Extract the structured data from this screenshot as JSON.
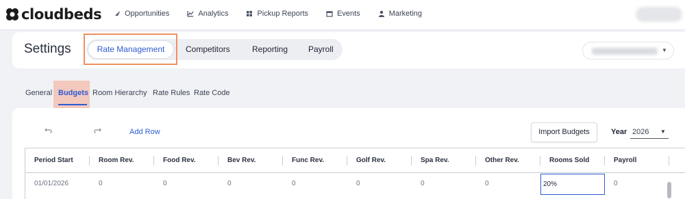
{
  "brand": {
    "name": "cloudbeds"
  },
  "nav": [
    {
      "label": "Opportunities",
      "icon": "rocket-icon"
    },
    {
      "label": "Analytics",
      "icon": "chart-icon"
    },
    {
      "label": "Pickup Reports",
      "icon": "grid-icon"
    },
    {
      "label": "Events",
      "icon": "calendar-icon"
    },
    {
      "label": "Marketing",
      "icon": "person-icon"
    }
  ],
  "settings": {
    "title": "Settings",
    "tabs": [
      "Rate Management",
      "Competitors",
      "Reporting",
      "Payroll"
    ],
    "active_tab": "Rate Management"
  },
  "subtabs": [
    "General",
    "Budgets",
    "Room Hierarchy",
    "Rate Rules",
    "Rate Code"
  ],
  "active_subtab": "Budgets",
  "toolbar": {
    "add_row_label": "Add Row",
    "import_label": "Import Budgets",
    "year_label": "Year",
    "year_value": "2026"
  },
  "table": {
    "columns": [
      "Period Start",
      "Room Rev.",
      "Food Rev.",
      "Bev Rev.",
      "Func Rev.",
      "Golf Rev.",
      "Spa Rev.",
      "Other Rev.",
      "Rooms Sold",
      "Payroll"
    ],
    "rows": [
      [
        "01/01/2026",
        "0",
        "0",
        "0",
        "0",
        "0",
        "0",
        "0",
        "20%",
        "0"
      ]
    ]
  },
  "colors": {
    "accent": "#2d5bd3",
    "highlight": "#f08f5e",
    "subtab_highlight": "#f3c8bd"
  }
}
